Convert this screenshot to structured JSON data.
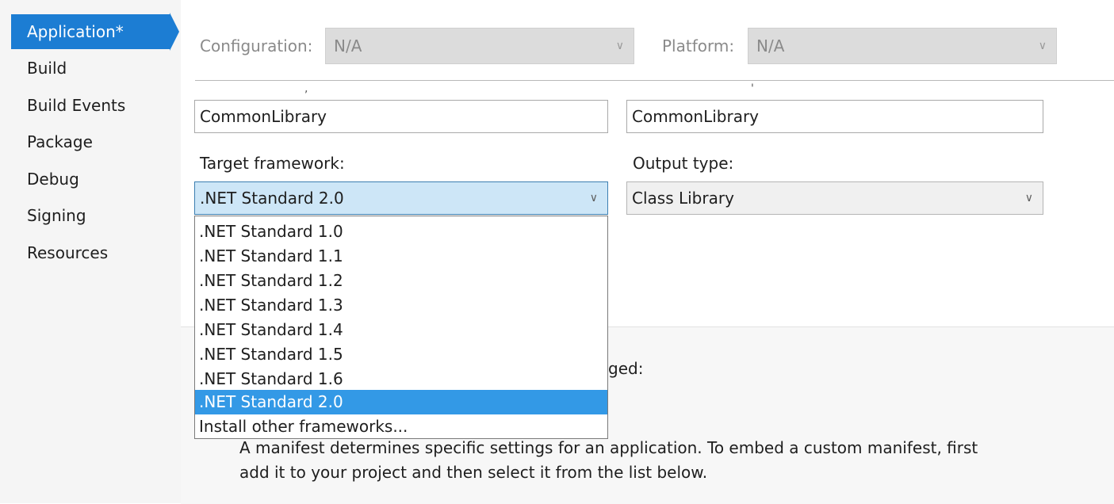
{
  "sidebar": {
    "items": [
      {
        "label": "Application*",
        "active": true
      },
      {
        "label": "Build"
      },
      {
        "label": "Build Events"
      },
      {
        "label": "Package"
      },
      {
        "label": "Debug"
      },
      {
        "label": "Signing"
      },
      {
        "label": "Resources"
      }
    ]
  },
  "config": {
    "configuration_label": "Configuration:",
    "configuration_value": "N/A",
    "platform_label": "Platform:",
    "platform_value": "N/A"
  },
  "fields": {
    "assembly_name_value": "CommonLibrary",
    "default_namespace_value": "CommonLibrary",
    "target_framework_label": "Target framework:",
    "target_framework_value": ".NET Standard 2.0",
    "output_type_label": "Output type:",
    "output_type_value": "Class Library"
  },
  "dropdown": {
    "options": [
      ".NET Standard 1.0",
      ".NET Standard 1.1",
      ".NET Standard 1.2",
      ".NET Standard 1.3",
      ".NET Standard 1.4",
      ".NET Standard 1.5",
      ".NET Standard 1.6",
      ".NET Standard 2.0",
      "Install other frameworks..."
    ],
    "selected_index": 7
  },
  "manifest": {
    "partial_label": "ged:",
    "description_line1": "A manifest determines specific settings for an application. To embed a custom manifest, first",
    "description_line2": "add it to your project and then select it from the list below."
  },
  "icons": {
    "dropdown_chevron": "chevron-down-icon"
  },
  "colors": {
    "accent": "#1c7dd3",
    "selection": "#3399e6",
    "combo_open_bg": "#cde6f7"
  }
}
